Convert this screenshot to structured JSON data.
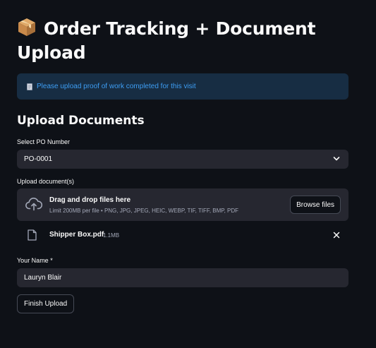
{
  "header": {
    "emoji_icon": "package-icon",
    "title": "Order Tracking + Document Upload"
  },
  "info_box": {
    "icon": "document-icon",
    "text": "Please upload proof of work completed for this visit",
    "color": "#3d9df3",
    "background": "#172d43"
  },
  "section": {
    "title": "Upload Documents"
  },
  "po_select": {
    "label": "Select PO Number",
    "value": "PO-0001",
    "icon": "chevron-down-icon"
  },
  "uploader": {
    "label": "Upload document(s)",
    "icon": "cloud-upload-icon",
    "title": "Drag and drop files here",
    "limit": "Limit 200MB per file • PNG, JPG, JPEG, HEIC, WEBP, TIF, TIFF, BMP, PDF",
    "browse_label": "Browse files"
  },
  "uploaded_file": {
    "icon": "file-icon",
    "name": "Shipper Box.pdf",
    "size": "1.1MB",
    "remove_icon": "close-icon"
  },
  "name_field": {
    "label": "Your Name *",
    "value": "Lauryn Blair"
  },
  "submit": {
    "label": "Finish Upload"
  },
  "theme": {
    "background": "#0e1117",
    "input_bg": "#262730",
    "text": "#fafafa",
    "muted_text": "#a3a8b8"
  }
}
